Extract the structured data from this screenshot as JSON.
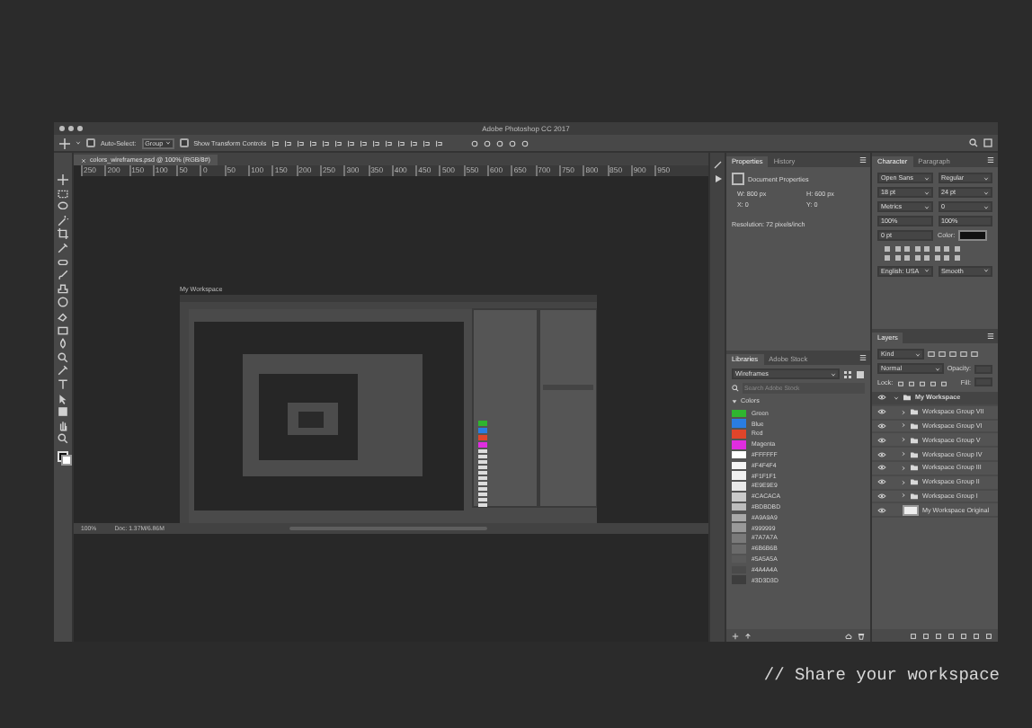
{
  "window": {
    "title": "Adobe Photoshop CC 2017"
  },
  "options_bar": {
    "auto_select": {
      "label": "Auto-Select:",
      "checked": false
    },
    "auto_select_value": "Group",
    "show_transform_controls": {
      "label": "Show Transform Controls",
      "checked": false
    }
  },
  "document": {
    "tab_title": "colors_wireframes.psd @ 100% (RGB/8#)",
    "ruler_labels": [
      "250",
      "200",
      "150",
      "100",
      "50",
      "0",
      "50",
      "100",
      "150",
      "200",
      "250",
      "300",
      "350",
      "400",
      "450",
      "500",
      "550",
      "600",
      "650",
      "700",
      "750",
      "800",
      "850",
      "900",
      "950"
    ],
    "canvas_label": "My Workspace",
    "zoom": "100%",
    "doc_info": "Doc: 1.37M/6.86M"
  },
  "properties_panel": {
    "tabs": [
      {
        "label": "Properties",
        "selected": true
      },
      {
        "label": "History",
        "selected": false
      }
    ],
    "heading": "Document Properties",
    "fields": [
      "W: 800 px",
      "H: 600 px",
      "X: 0",
      "Y: 0"
    ],
    "resolution": "Resolution: 72 pixels/inch"
  },
  "libraries_panel": {
    "tabs": [
      {
        "label": "Libraries",
        "selected": true
      },
      {
        "label": "Adobe Stock",
        "selected": false
      }
    ],
    "library": "Wireframes",
    "search": {
      "placeholder": "Search Adobe Stock"
    },
    "section": {
      "label": "Colors",
      "expanded": true
    },
    "swatches": [
      {
        "name": "Green",
        "color": "#2fb52f"
      },
      {
        "name": "Blue",
        "color": "#2a7de1"
      },
      {
        "name": "Red",
        "color": "#e0452a"
      },
      {
        "name": "Magenta",
        "color": "#e02de0"
      },
      {
        "name": "#FFFFFF",
        "color": "#ffffff"
      },
      {
        "name": "#F4F4F4",
        "color": "#f4f4f4"
      },
      {
        "name": "#F1F1F1",
        "color": "#f1f1f1"
      },
      {
        "name": "#E9E9E9",
        "color": "#e9e9e9"
      },
      {
        "name": "#CACACA",
        "color": "#cacaca"
      },
      {
        "name": "#BDBDBD",
        "color": "#bdbdbd"
      },
      {
        "name": "#A9A9A9",
        "color": "#a9a9a9"
      },
      {
        "name": "#999999",
        "color": "#999999"
      },
      {
        "name": "#7A7A7A",
        "color": "#7a7a7a"
      },
      {
        "name": "#6B6B6B",
        "color": "#6b6b6b"
      },
      {
        "name": "#5A5A5A",
        "color": "#5a5a5a"
      },
      {
        "name": "#4A4A4A",
        "color": "#4a4a4a"
      },
      {
        "name": "#3D3D3D",
        "color": "#3d3d3d"
      }
    ]
  },
  "character_panel": {
    "tabs": [
      {
        "label": "Character",
        "selected": true
      },
      {
        "label": "Paragraph",
        "selected": false
      }
    ],
    "font_family": "Open Sans",
    "font_style": "Regular",
    "size": "18 pt",
    "leading": "24 pt",
    "kerning": "Metrics",
    "tracking": "0",
    "vertical_scale": "100%",
    "horizontal_scale": "100%",
    "baseline_shift": "0 pt",
    "color_label": "Color:",
    "language": "English: USA",
    "antialias": "Smooth"
  },
  "layers_panel": {
    "tab": "Layers",
    "filter": "Kind",
    "blend_mode": "Normal",
    "opacity_label": "Opacity:",
    "lock_label": "Lock:",
    "fill_label": "Fill:",
    "layers": [
      {
        "name": "My Workspace",
        "kind": "group",
        "expanded": true,
        "selected": true,
        "visible": true,
        "children": [
          {
            "name": "Workspace Group VII",
            "kind": "group",
            "expanded": false,
            "selected": false,
            "visible": true
          },
          {
            "name": "Workspace Group VI",
            "kind": "group",
            "expanded": false,
            "selected": false,
            "visible": true
          },
          {
            "name": "Workspace Group V",
            "kind": "group",
            "expanded": false,
            "selected": false,
            "visible": true
          },
          {
            "name": "Workspace Group IV",
            "kind": "group",
            "expanded": false,
            "selected": false,
            "visible": true
          },
          {
            "name": "Workspace Group III",
            "kind": "group",
            "expanded": false,
            "selected": false,
            "visible": true
          },
          {
            "name": "Workspace Group II",
            "kind": "group",
            "expanded": false,
            "selected": false,
            "visible": true
          },
          {
            "name": "Workspace Group I",
            "kind": "group",
            "expanded": false,
            "selected": false,
            "visible": true
          }
        ]
      },
      {
        "name": "My Workspace Original",
        "kind": "image",
        "selected": false,
        "visible": true
      }
    ]
  },
  "caption": "// Share your workspace"
}
